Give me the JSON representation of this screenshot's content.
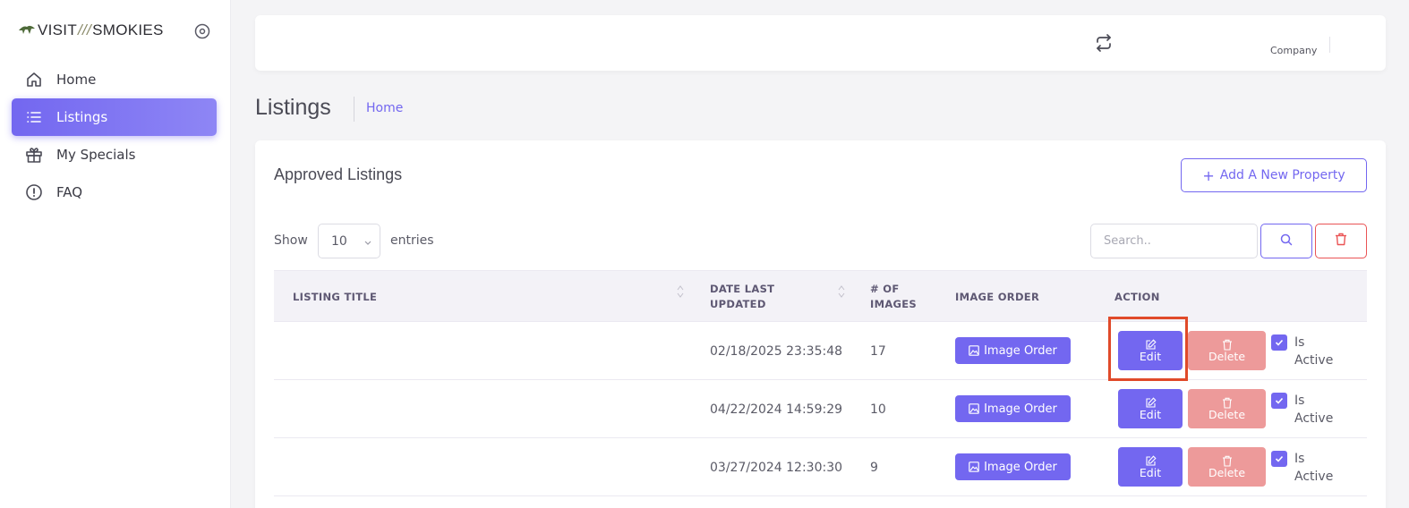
{
  "brand": {
    "left": "VISIT",
    "slash": "///",
    "right": "SMOKIES"
  },
  "sidebar": {
    "items": [
      {
        "label": "Home",
        "icon": "home-icon",
        "active": false
      },
      {
        "label": "Listings",
        "icon": "list-icon",
        "active": true
      },
      {
        "label": "My Specials",
        "icon": "gift-icon",
        "active": false
      },
      {
        "label": "FAQ",
        "icon": "info-icon",
        "active": false
      }
    ]
  },
  "topbar": {
    "company": "Company"
  },
  "page": {
    "title": "Listings",
    "breadcrumb": "Home"
  },
  "card": {
    "title": "Approved Listings",
    "add_button": "Add A New Property",
    "show_label": "Show",
    "entries_value": "10",
    "entries_label": "entries",
    "search_placeholder": "Search.."
  },
  "table": {
    "headers": {
      "title": "LISTING TITLE",
      "date_line1": "DATE LAST",
      "date_line2": "UPDATED",
      "images_line1": "# OF",
      "images_line2": "IMAGES",
      "image_order": "IMAGE ORDER",
      "action": "ACTION"
    },
    "rows": [
      {
        "title": "",
        "date": "02/18/2025 23:35:48",
        "images": "17",
        "image_order": "Image Order",
        "edit": "Edit",
        "delete": "Delete",
        "active_line1": "Is",
        "active_line2": "Active"
      },
      {
        "title": "",
        "date": "04/22/2024 14:59:29",
        "images": "10",
        "image_order": "Image Order",
        "edit": "Edit",
        "delete": "Delete",
        "active_line1": "Is",
        "active_line2": "Active"
      },
      {
        "title": "",
        "date": "03/27/2024 12:30:30",
        "images": "9",
        "image_order": "Image Order",
        "edit": "Edit",
        "delete": "Delete",
        "active_line1": "Is",
        "active_line2": "Active"
      }
    ]
  },
  "colors": {
    "accent": "#7367f0",
    "danger": "#ea5455",
    "danger_soft": "#ed9a9a",
    "highlight": "#e04a2a"
  }
}
